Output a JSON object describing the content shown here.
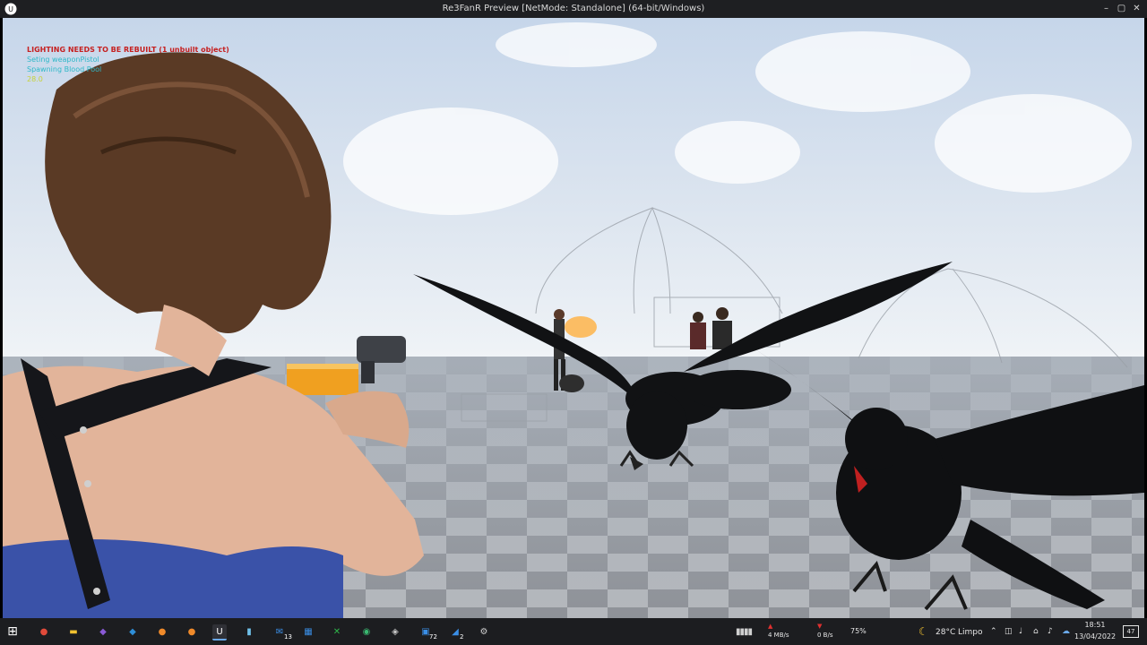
{
  "window": {
    "title": "Re3FanR Preview [NetMode: Standalone]  (64-bit/Windows)",
    "minimize": "–",
    "maximize": "▢",
    "close": "✕"
  },
  "hud": {
    "warning": "LIGHTING NEEDS TO BE REBUILT (1 unbuilt object)",
    "messages": [
      "Seting weaponPistol",
      "Spawning Blood Pool"
    ],
    "fps": "28.0"
  },
  "scene": {
    "sky_color": "#d6e1ee",
    "floor_color": "#9fa3a9",
    "crate_color": "#f0a020"
  },
  "taskbar": {
    "apps": [
      {
        "name": "windows-start",
        "glyph": "⊞",
        "color": "#ffffff"
      },
      {
        "name": "chrome",
        "glyph": "●",
        "color": "#e04a3a"
      },
      {
        "name": "file-explorer",
        "glyph": "▬",
        "color": "#f2c230"
      },
      {
        "name": "visual-studio",
        "glyph": "◆",
        "color": "#8a5ad6"
      },
      {
        "name": "vscode",
        "glyph": "◆",
        "color": "#2f8fd8"
      },
      {
        "name": "blender",
        "glyph": "●",
        "color": "#f08a2a"
      },
      {
        "name": "blender-2",
        "glyph": "●",
        "color": "#f08a2a"
      },
      {
        "name": "unreal-engine",
        "glyph": "U",
        "color": "#ffffff"
      },
      {
        "name": "notepad",
        "glyph": "▮",
        "color": "#6fc0e8"
      },
      {
        "name": "mail",
        "glyph": "✉",
        "color": "#3a8ee6"
      },
      {
        "name": "calculator",
        "glyph": "▦",
        "color": "#3a8ee6"
      },
      {
        "name": "xbox",
        "glyph": "✕",
        "color": "#2fb64a"
      },
      {
        "name": "app-green",
        "glyph": "◉",
        "color": "#3ab870"
      },
      {
        "name": "shield",
        "glyph": "◈",
        "color": "#c8c8c8"
      },
      {
        "name": "photos",
        "glyph": "▣",
        "color": "#3a8ee6"
      },
      {
        "name": "tool-blue",
        "glyph": "◢",
        "color": "#3a8ee6"
      },
      {
        "name": "settings-circle",
        "glyph": "⚙",
        "color": "#d0d0d0"
      }
    ],
    "badges": {
      "mail": "13",
      "photos": "72",
      "tool": "2"
    },
    "net_up": "4 MB/s",
    "net_down": "0 B/s",
    "cpu": "75%",
    "temperature": "28°C",
    "weather": "Limpo",
    "time": "18:51",
    "date": "13/04/2022",
    "notifications": "47"
  }
}
